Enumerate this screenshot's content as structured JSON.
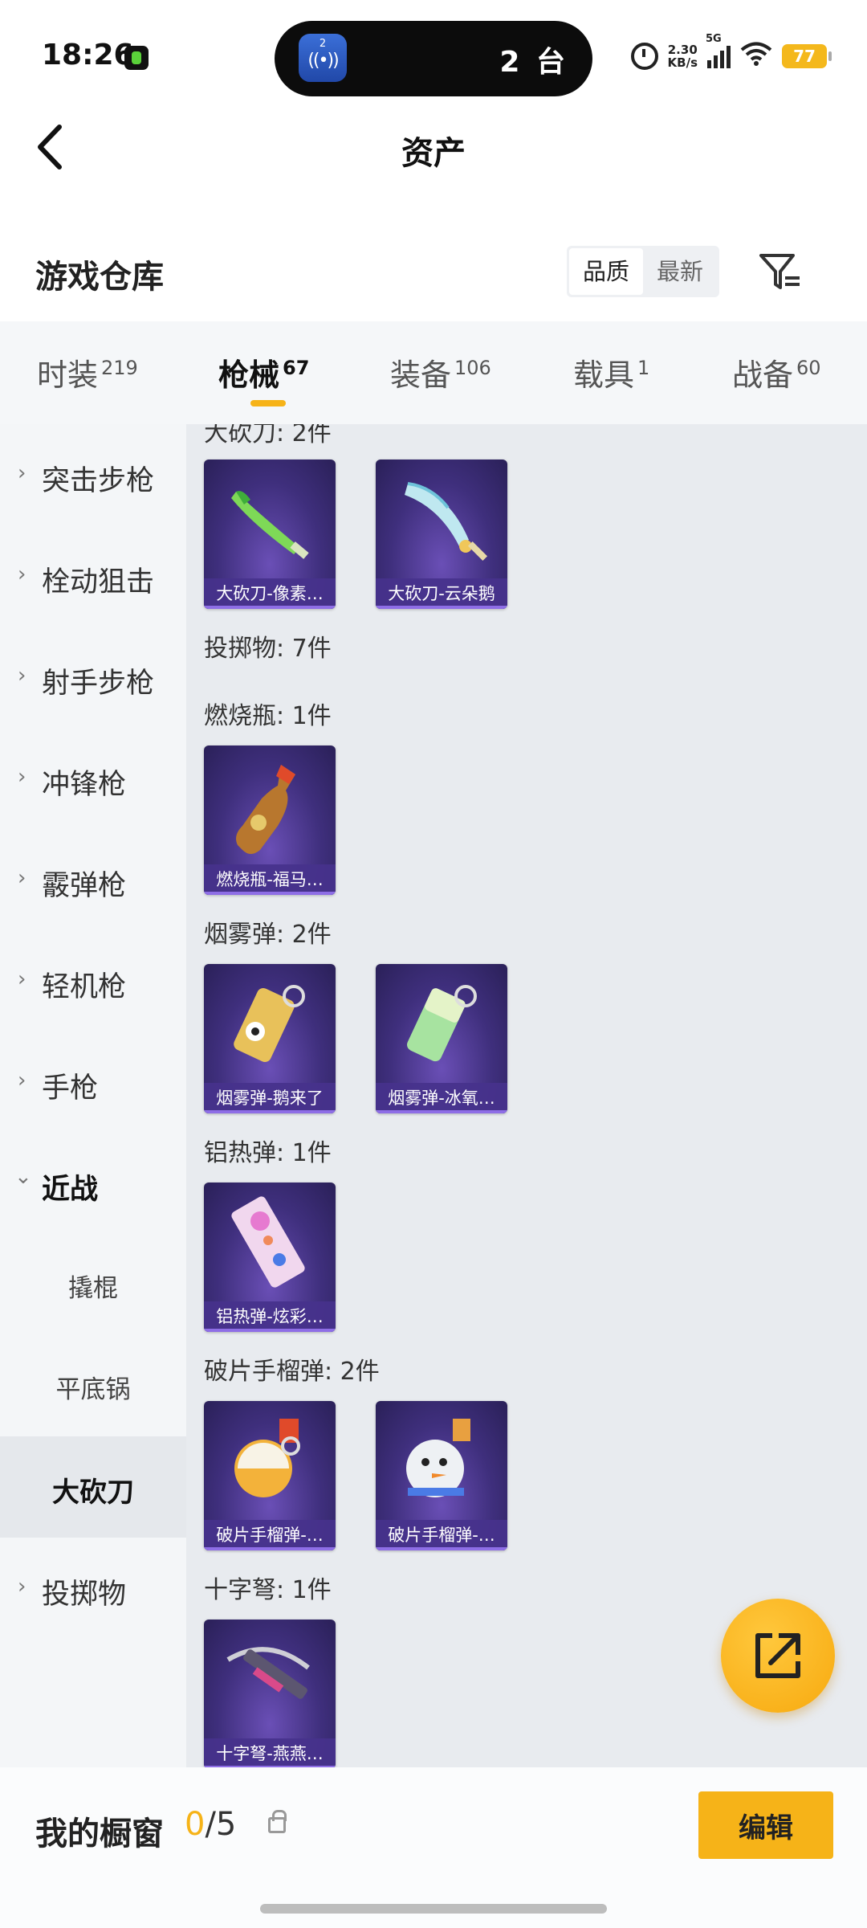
{
  "status_bar": {
    "time": "18:26",
    "island_badge": "2",
    "island_text": "2 台",
    "net_speed_value": "2.30",
    "net_speed_unit": "KB/s",
    "network": "5G",
    "battery": "77"
  },
  "header": {
    "title": "资产"
  },
  "warehouse": {
    "title": "游戏仓库",
    "sort_options": [
      "品质",
      "最新"
    ],
    "active_sort": "品质"
  },
  "tabs": [
    {
      "label": "时装",
      "count": "219"
    },
    {
      "label": "枪械",
      "count": "67"
    },
    {
      "label": "装备",
      "count": "106"
    },
    {
      "label": "载具",
      "count": "1"
    },
    {
      "label": "战备",
      "count": "60"
    }
  ],
  "active_tab": "枪械",
  "sidebar": {
    "items": [
      {
        "label": "突击步枪"
      },
      {
        "label": "栓动狙击"
      },
      {
        "label": "射手步枪"
      },
      {
        "label": "冲锋枪"
      },
      {
        "label": "霰弹枪"
      },
      {
        "label": "轻机枪"
      },
      {
        "label": "手枪"
      },
      {
        "label": "近战"
      },
      {
        "label": "撬棍"
      },
      {
        "label": "平底锅"
      },
      {
        "label": "大砍刀"
      },
      {
        "label": "投掷物"
      }
    ],
    "selected": "大砍刀"
  },
  "content": {
    "sections": [
      {
        "label": "大砍刀: 2件"
      },
      {
        "label": "投掷物: 7件"
      },
      {
        "label": "燃烧瓶: 1件"
      },
      {
        "label": "烟雾弹: 2件"
      },
      {
        "label": "铝热弹: 1件"
      },
      {
        "label": "破片手榴弹: 2件"
      },
      {
        "label": "十字弩: 1件"
      }
    ],
    "items": [
      {
        "name": "大砍刀-像素…",
        "icon": "green-machete-icon"
      },
      {
        "name": "大砍刀-云朵鹅",
        "icon": "cloud-goose-machete-icon"
      },
      {
        "name": "燃烧瓶-福马…",
        "icon": "molotov-bottle-icon"
      },
      {
        "name": "烟雾弹-鹅来了",
        "icon": "goose-smoke-grenade-icon"
      },
      {
        "name": "烟雾弹-冰氧…",
        "icon": "ice-smoke-grenade-icon"
      },
      {
        "name": "铝热弹-炫彩…",
        "icon": "candy-thermite-icon"
      },
      {
        "name": "破片手榴弹-…",
        "icon": "orange-frag-grenade-icon"
      },
      {
        "name": "破片手榴弹-…",
        "icon": "snowman-frag-grenade-icon"
      },
      {
        "name": "十字弩-燕燕…",
        "icon": "crossbow-icon"
      }
    ]
  },
  "bottom_bar": {
    "label": "我的橱窗",
    "current": "0",
    "total": "/5",
    "edit_label": "编辑"
  },
  "colors": {
    "accent": "#f6b318",
    "card_bg": "#3f2f7d",
    "card_label": "#46328c"
  }
}
